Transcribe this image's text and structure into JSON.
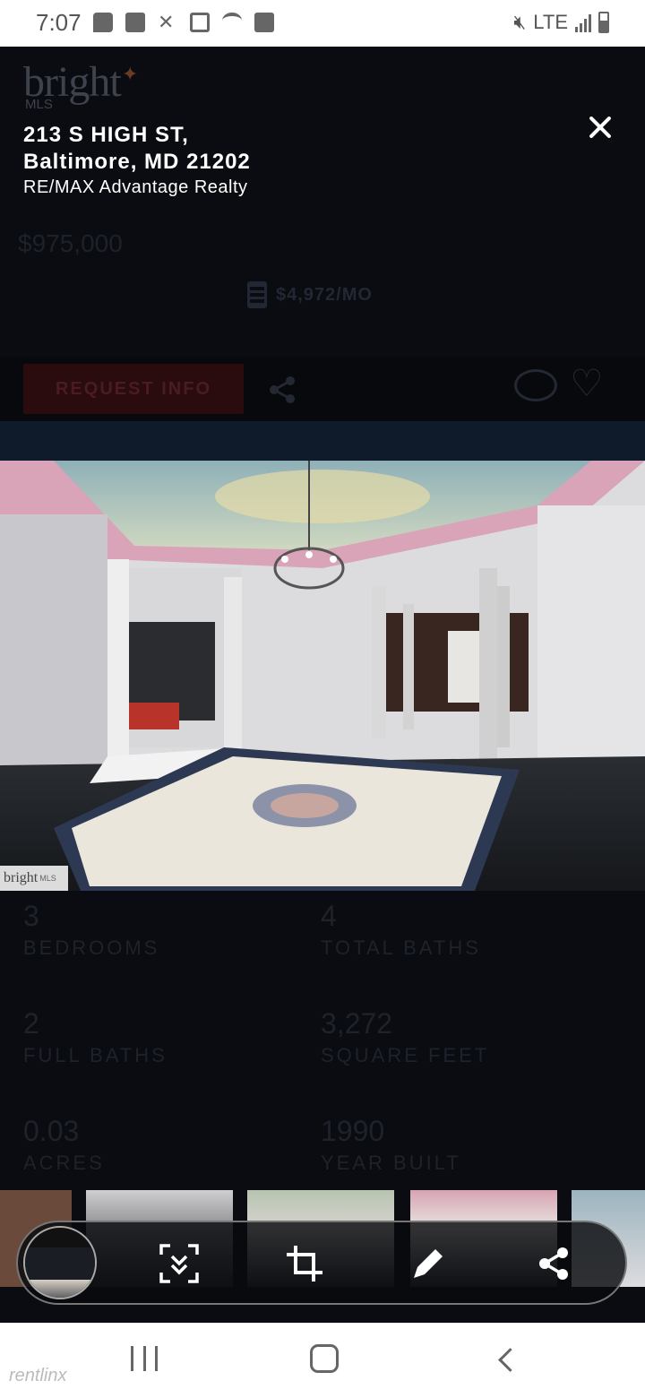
{
  "status_bar": {
    "time": "7:07",
    "network": "LTE"
  },
  "listing": {
    "logo_text": "bright",
    "logo_sub": "MLS",
    "address_line1": "213 S HIGH ST,",
    "address_line2": "Baltimore, MD 21202",
    "broker": "RE/MAX Advantage Realty",
    "price": "$975,000",
    "mortgage": "$4,972/MO",
    "request_info_label": "REQUEST INFO",
    "stats": [
      {
        "value": "3",
        "label": "BEDROOMS"
      },
      {
        "value": "4",
        "label": "TOTAL BATHS"
      },
      {
        "value": "2",
        "label": "FULL BATHS"
      },
      {
        "value": "3,272",
        "label": "SQUARE FEET"
      },
      {
        "value": "0.03",
        "label": "ACRES"
      },
      {
        "value": "1990",
        "label": "YEAR BUILT"
      }
    ]
  },
  "photo": {
    "badge_brand": "bright",
    "badge_sub": "MLS"
  },
  "toolbar": {
    "icons": [
      "scroll-capture-icon",
      "crop-icon",
      "edit-icon",
      "share-icon"
    ]
  },
  "watermark": "rentlinx",
  "colors": {
    "overlay": "#0a0c12",
    "accent_logo": "#e8762a"
  }
}
